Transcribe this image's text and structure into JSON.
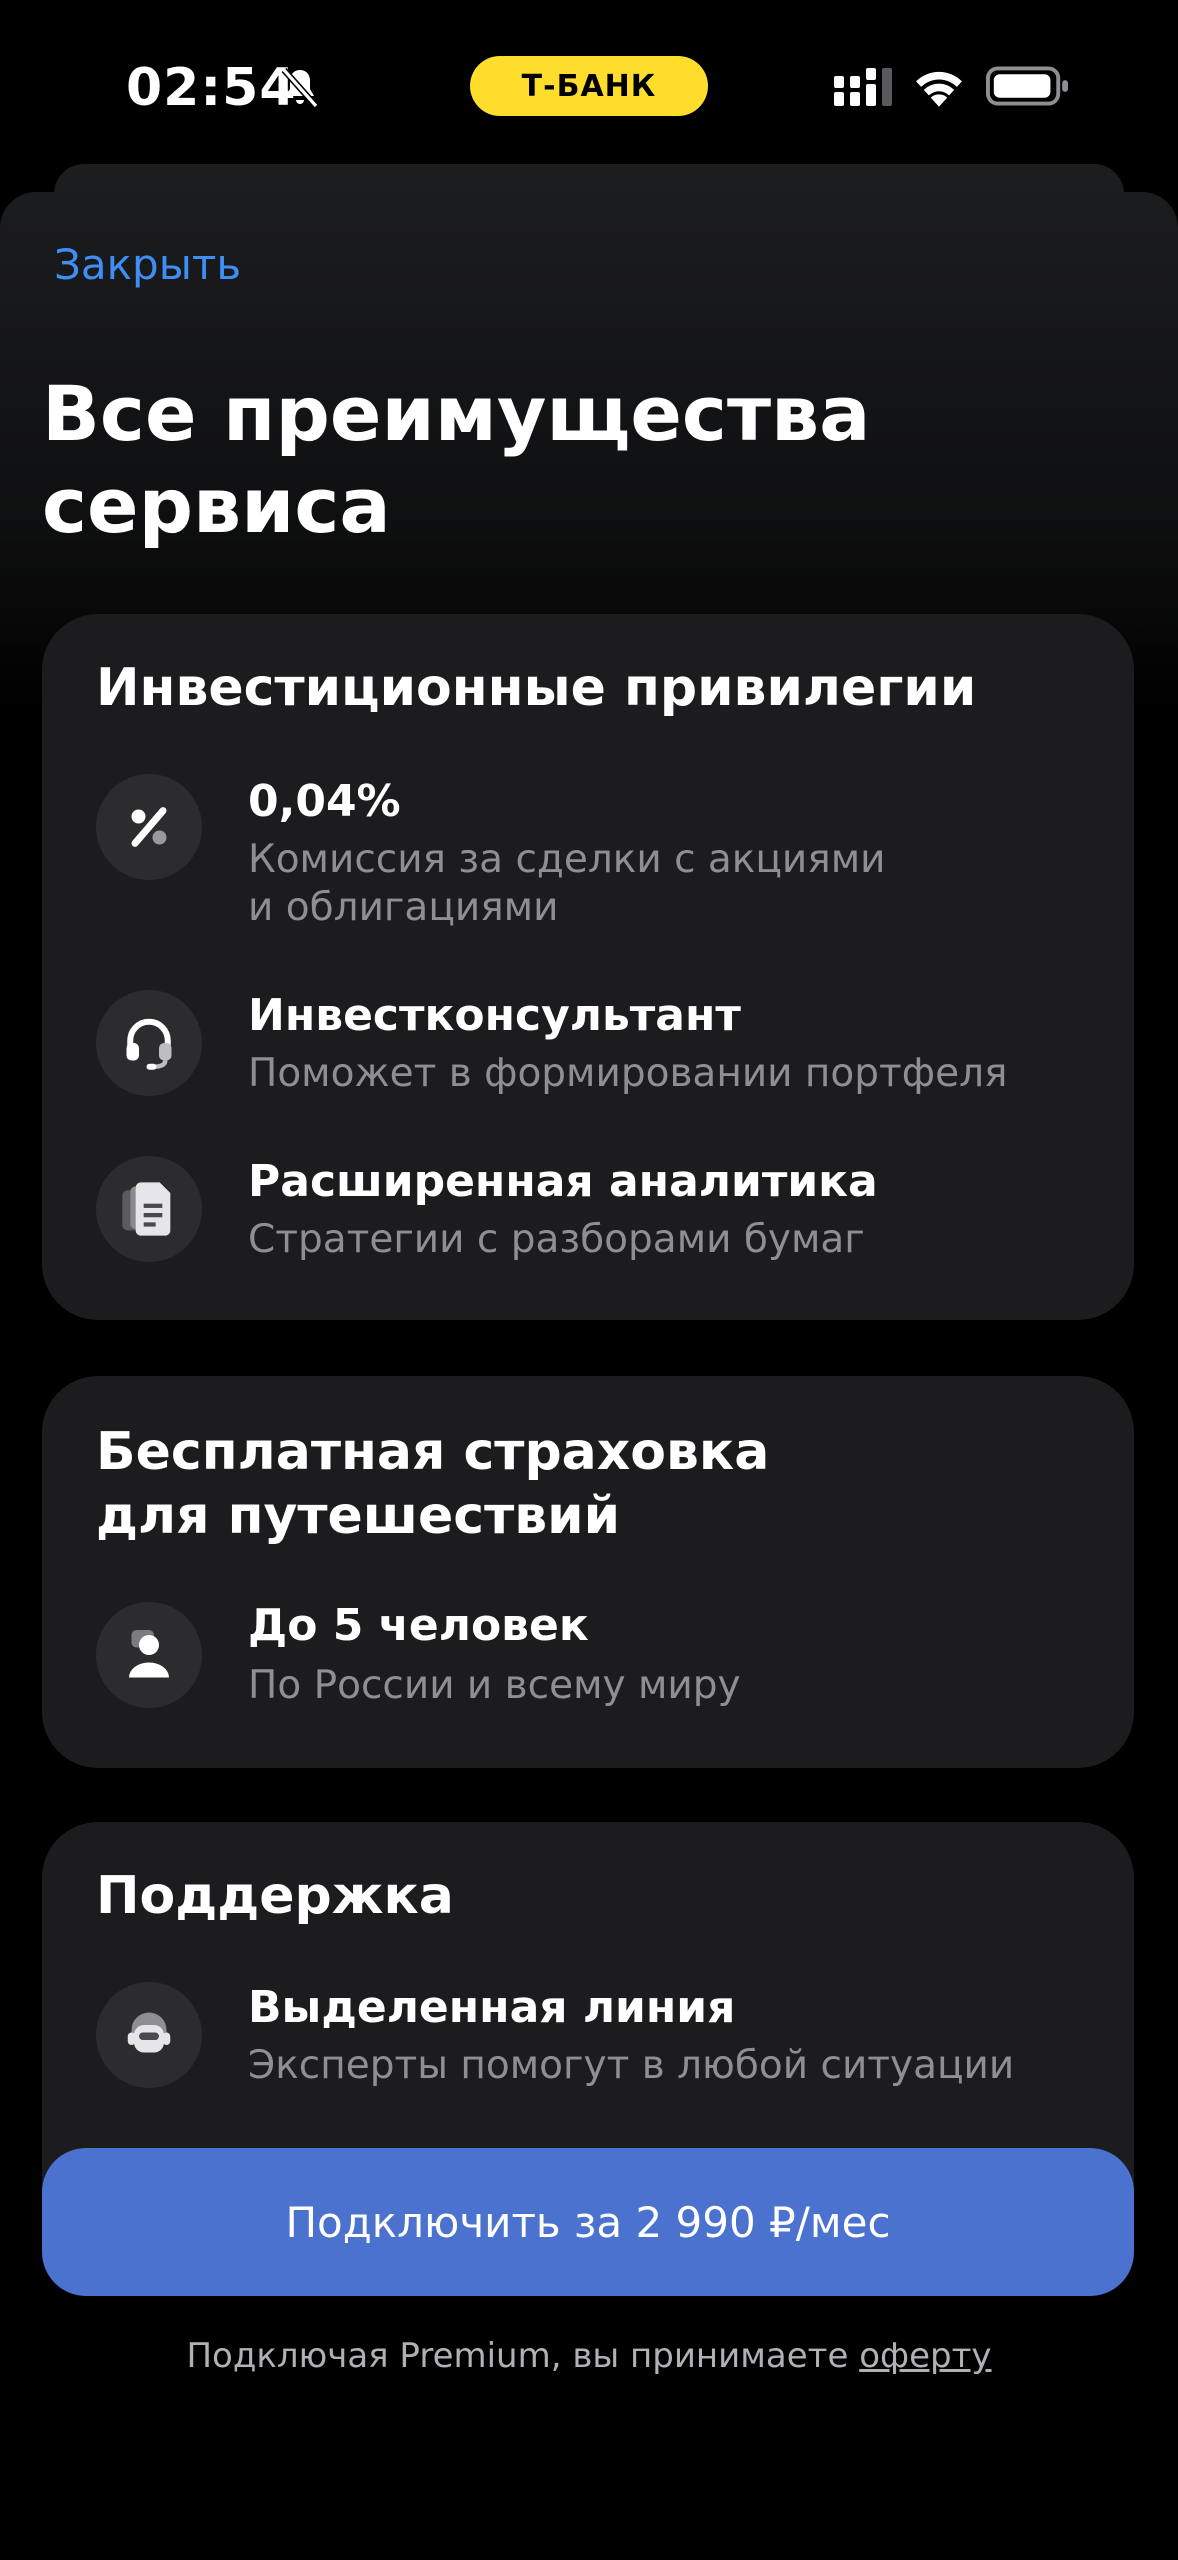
{
  "status_bar": {
    "time": "02:54",
    "carrier_badge": "Т-БАНК",
    "icons": [
      "bell-slash-icon",
      "cellular-signal-icon",
      "wifi-icon",
      "battery-icon"
    ],
    "badge_color": "#FFDD2D"
  },
  "header": {
    "close_label": "Закрыть",
    "title_line1": "Все преимущества",
    "title_line2": "сервиса"
  },
  "sections": [
    {
      "title": "Инвестиционные привилегии",
      "items": [
        {
          "icon": "percent-icon",
          "title": "0,04%",
          "subtitle_line1": "Комиссия за сделки с акциями",
          "subtitle_line2": "и облигациями"
        },
        {
          "icon": "headset-icon",
          "title": "Инвестконсультант",
          "subtitle": "Поможет в формировании портфеля"
        },
        {
          "icon": "documents-icon",
          "title": "Расширенная аналитика",
          "subtitle": "Стратегии с разборами бумаг"
        }
      ]
    },
    {
      "title_line1": "Бесплатная страховка",
      "title_line2": "для путешествий",
      "items": [
        {
          "icon": "traveler-icon",
          "title": "До 5 человек",
          "subtitle": "По России и всему миру"
        }
      ]
    },
    {
      "title": "Поддержка",
      "items": [
        {
          "icon": "support-agent-icon",
          "title": "Выделенная линия",
          "subtitle": "Эксперты помогут в любой ситуации"
        }
      ]
    }
  ],
  "cta": {
    "label": "Подключить за 2 990 ₽/мес",
    "color": "#4C72D0"
  },
  "footer": {
    "note": "Подключая Premium, вы принимаете ",
    "link": "оферту"
  },
  "colors": {
    "accent_link": "#3F8EF3",
    "card_bg": "#1C1C1E",
    "secondary_text": "#8E8E93"
  }
}
